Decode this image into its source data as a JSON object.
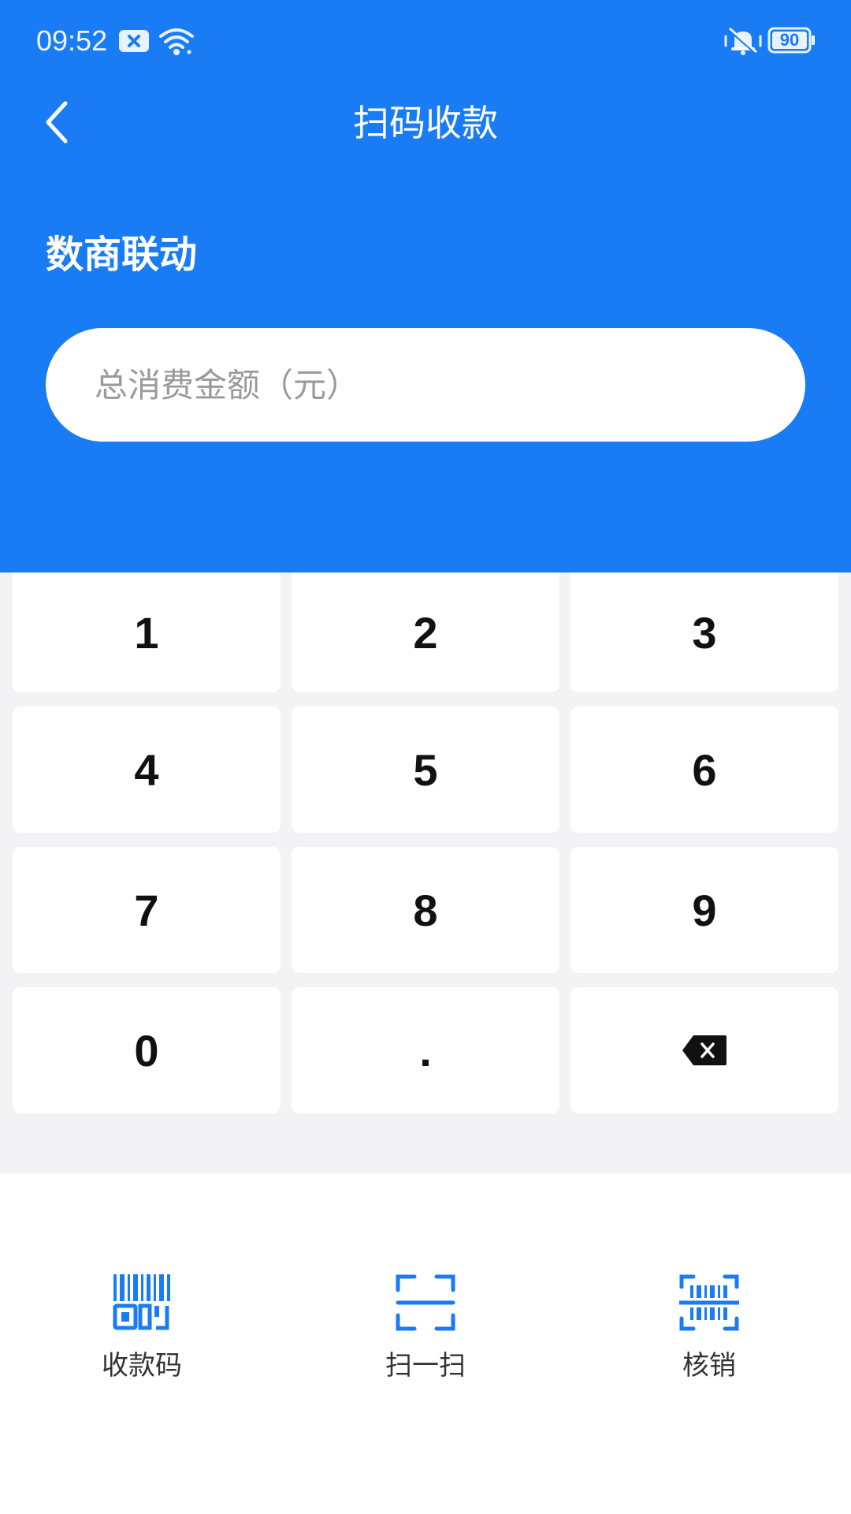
{
  "status_bar": {
    "time": "09:52",
    "battery": "90"
  },
  "header": {
    "title": "扫码收款",
    "merchant_name": "数商联动"
  },
  "amount": {
    "value": "",
    "placeholder": "总消费金额（元）"
  },
  "keypad": {
    "keys": [
      "1",
      "2",
      "3",
      "4",
      "5",
      "6",
      "7",
      "8",
      "9",
      "0",
      "."
    ],
    "backspace_icon": "backspace-icon"
  },
  "actions": [
    {
      "label": "收款码",
      "icon": "payment-qr-code-icon"
    },
    {
      "label": "扫一扫",
      "icon": "scan-frame-icon"
    },
    {
      "label": "核销",
      "icon": "barcode-verify-icon"
    }
  ],
  "colors": {
    "primary": "#1a7cf5",
    "keypad_bg": "#f3f3f5",
    "key_bg": "#ffffff"
  }
}
